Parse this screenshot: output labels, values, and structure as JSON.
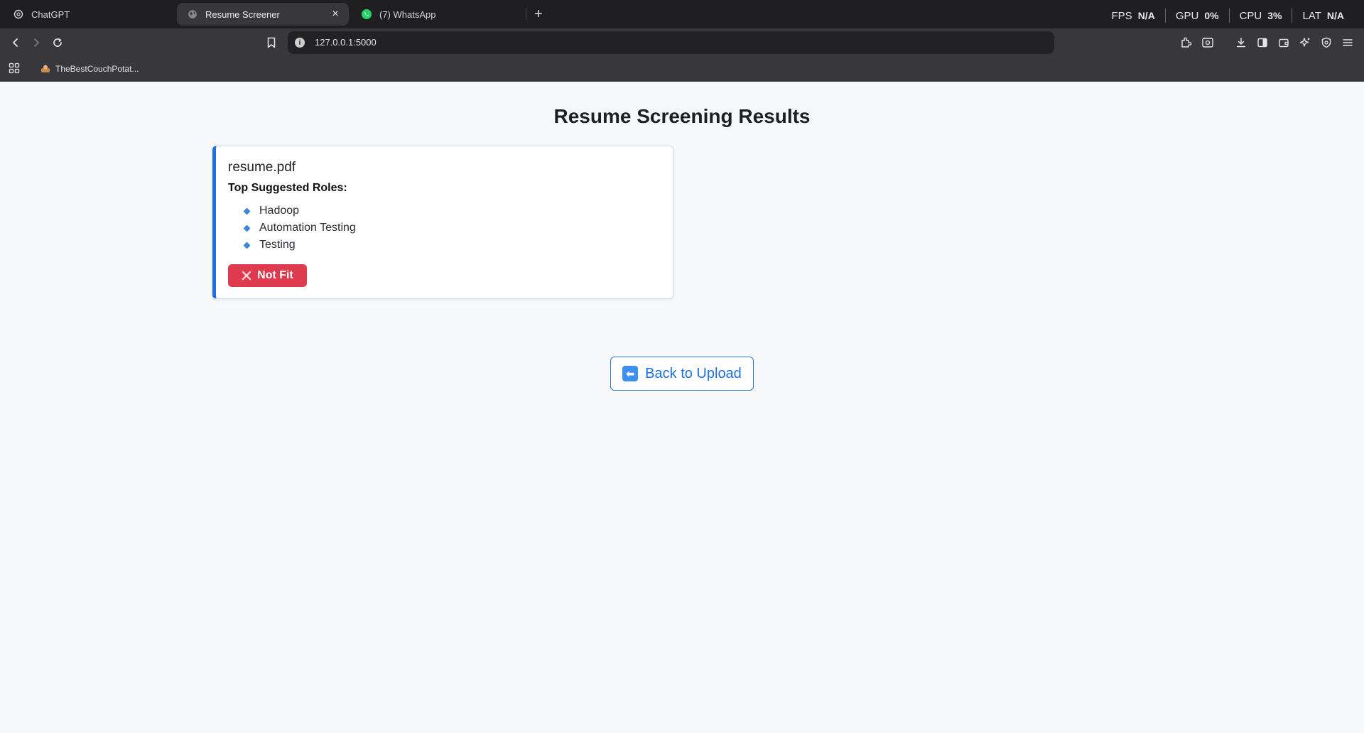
{
  "browser": {
    "tabs": [
      {
        "title": "ChatGPT",
        "icon": "chatgpt-icon",
        "active": false
      },
      {
        "title": "Resume Screener",
        "icon": "globe-icon",
        "active": true
      },
      {
        "title": "(7) WhatsApp",
        "icon": "whatsapp-icon",
        "active": false
      }
    ],
    "close_glyph": "×",
    "new_tab_glyph": "+",
    "perf": {
      "fps_label": "FPS",
      "fps_value": "N/A",
      "gpu_label": "GPU",
      "gpu_value": "0%",
      "cpu_label": "CPU",
      "cpu_value": "3%",
      "lat_label": "LAT",
      "lat_value": "N/A"
    },
    "url": "127.0.0.1:5000",
    "bookmark": {
      "label": "TheBestCouchPotat..."
    }
  },
  "page": {
    "title": "Resume Screening Results",
    "result": {
      "file_name": "resume.pdf",
      "roles_heading": "Top Suggested Roles:",
      "roles": [
        "Hadoop",
        "Automation Testing",
        "Testing"
      ],
      "status_label": "Not Fit",
      "status_color": "#e03a4f",
      "accent_color": "#1f6fe0"
    },
    "back_button_label": "Back to Upload"
  }
}
